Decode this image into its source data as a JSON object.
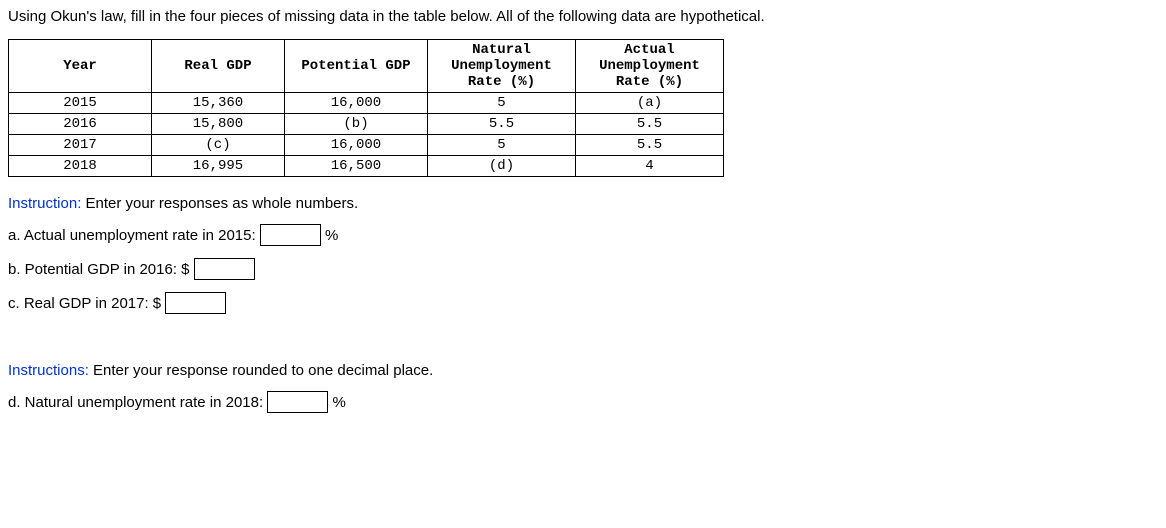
{
  "intro": "Using Okun's law, fill in the four pieces of missing data in the table below. All of the following data are hypothetical.",
  "table": {
    "headers": {
      "year": "Year",
      "real_gdp": "Real GDP",
      "potential_gdp": "Potential GDP",
      "natural": "Natural Unemployment Rate (%)",
      "actual": "Actual Unemployment Rate (%)"
    },
    "rows": [
      {
        "year": "2015",
        "real_gdp": "15,360",
        "potential_gdp": "16,000",
        "natural": "5",
        "actual": "(a)"
      },
      {
        "year": "2016",
        "real_gdp": "15,800",
        "potential_gdp": "(b)",
        "natural": "5.5",
        "actual": "5.5"
      },
      {
        "year": "2017",
        "real_gdp": "(c)",
        "potential_gdp": "16,000",
        "natural": "5",
        "actual": "5.5"
      },
      {
        "year": "2018",
        "real_gdp": "16,995",
        "potential_gdp": "16,500",
        "natural": "(d)",
        "actual": "4"
      }
    ]
  },
  "instruction1_label": "Instruction:",
  "instruction1_text": " Enter your responses as whole numbers.",
  "q": {
    "a": {
      "label": "a. Actual unemployment rate in 2015: ",
      "suffix": " %"
    },
    "b": {
      "label": "b. Potential GDP in 2016: $ "
    },
    "c": {
      "label": "c. Real GDP in 2017: $ "
    },
    "d": {
      "label": "d. Natural unemployment rate in 2018: ",
      "suffix": " %"
    }
  },
  "instruction2_label": "Instructions:",
  "instruction2_text": " Enter your response rounded to one decimal place."
}
